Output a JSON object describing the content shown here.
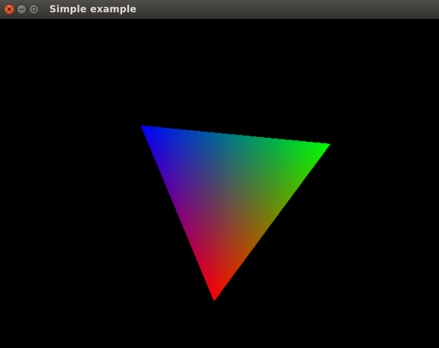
{
  "window": {
    "title": "Simple example"
  },
  "controls": {
    "close_icon": "close-icon",
    "minimize_icon": "minimize-icon",
    "maximize_icon": "maximize-icon"
  },
  "scene": {
    "background": "#000000",
    "vertex_colors": [
      "#0000ff",
      "#00ff00",
      "#ff0000"
    ]
  }
}
